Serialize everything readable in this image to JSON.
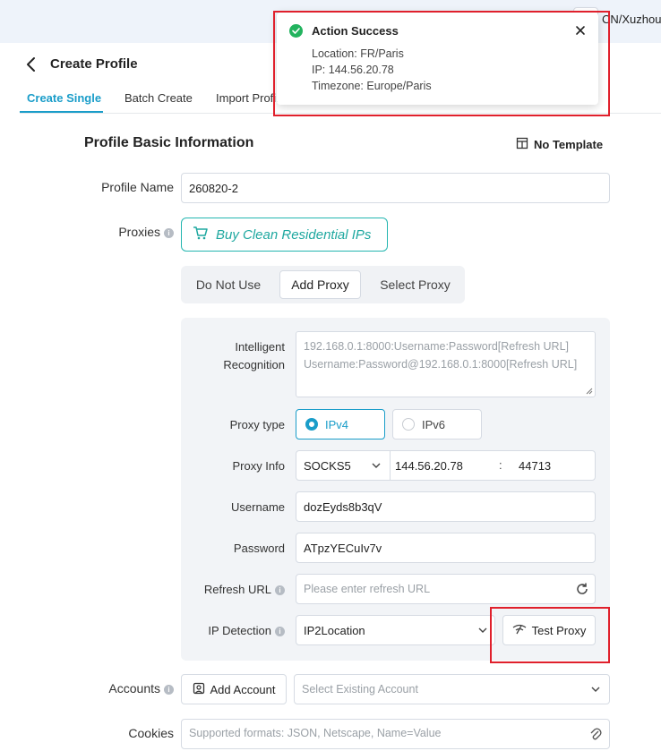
{
  "topbar": {
    "location": "CN/Xuzhou"
  },
  "header": {
    "title": "Create Profile"
  },
  "tabs": [
    {
      "label": "Create Single"
    },
    {
      "label": "Batch Create"
    },
    {
      "label": "Import Profile"
    }
  ],
  "section": {
    "title": "Profile Basic Information",
    "template_label": "No Template"
  },
  "profile_name": {
    "label": "Profile Name",
    "value": "260820-2"
  },
  "proxies": {
    "label": "Proxies",
    "buy_button": "Buy Clean Residential IPs",
    "modes": [
      "Do Not Use",
      "Add Proxy",
      "Select Proxy"
    ],
    "selected_mode": "Add Proxy"
  },
  "proxy_form": {
    "intelligent_label_1": "Intelligent",
    "intelligent_label_2": "Recognition",
    "intelligent_placeholder_1": "192.168.0.1:8000:Username:Password[Refresh URL]",
    "intelligent_placeholder_2": "Username:Password@192.168.0.1:8000[Refresh URL]",
    "proxy_type_label": "Proxy type",
    "ipv4": "IPv4",
    "ipv6": "IPv6",
    "selected_type": "IPv4",
    "proxy_info_label": "Proxy Info",
    "protocol": "SOCKS5",
    "host": "144.56.20.78",
    "separator": ":",
    "port": "44713",
    "username_label": "Username",
    "username": "dozEyds8b3qV",
    "password_label": "Password",
    "password": "ATpzYECuIv7v",
    "refresh_label": "Refresh URL",
    "refresh_placeholder": "Please enter refresh URL",
    "ip_detection_label": "IP Detection",
    "ip_detection_value": "IP2Location",
    "test_button": "Test Proxy"
  },
  "accounts": {
    "label": "Accounts",
    "add_button": "Add Account",
    "select_placeholder": "Select Existing Account"
  },
  "cookies": {
    "label": "Cookies",
    "placeholder": "Supported formats: JSON, Netscape, Name=Value"
  },
  "toast": {
    "title": "Action Success",
    "location": "Location: FR/Paris",
    "ip": "IP: 144.56.20.78",
    "timezone": "Timezone: Europe/Paris"
  },
  "colors": {
    "accent": "#1a9dc9",
    "teal": "#24b6b0",
    "success": "#22b35e",
    "highlight": "#e0202c"
  }
}
